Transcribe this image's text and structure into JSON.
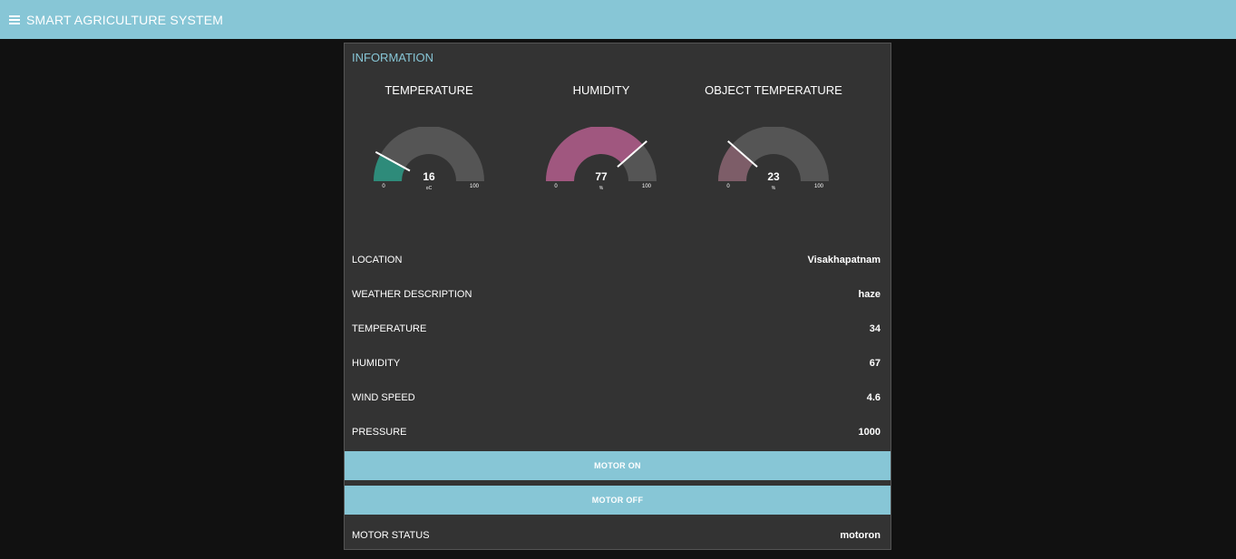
{
  "header": {
    "title": "SMART AGRICULTURE SYSTEM",
    "menu_icon": "hamburger-menu-icon"
  },
  "card": {
    "title": "INFORMATION"
  },
  "gauges": [
    {
      "title": "TEMPERATURE",
      "value": 16,
      "value_text": "16",
      "unit": "oC",
      "min": 0,
      "min_text": "0",
      "max": 100,
      "max_text": "100",
      "color": "#2e8b7a"
    },
    {
      "title": "HUMIDITY",
      "value": 77,
      "value_text": "77",
      "unit": "%",
      "min": 0,
      "min_text": "0",
      "max": 100,
      "max_text": "100",
      "color": "#a0577f"
    },
    {
      "title": "OBJECT TEMPERATURE",
      "value": 23,
      "value_text": "23",
      "unit": "%",
      "min": 0,
      "min_text": "0",
      "max": 100,
      "max_text": "100",
      "color": "#7d5d68"
    }
  ],
  "info_rows": [
    {
      "label": "LOCATION",
      "value": "Visakhapatnam"
    },
    {
      "label": "WEATHER DESCRIPTION",
      "value": "haze"
    },
    {
      "label": "TEMPERATURE",
      "value": "34"
    },
    {
      "label": "HUMIDITY",
      "value": "67"
    },
    {
      "label": "WIND SPEED",
      "value": "4.6"
    },
    {
      "label": "PRESSURE",
      "value": "1000"
    }
  ],
  "buttons": {
    "motor_on": "MOTOR ON",
    "motor_off": "MOTOR OFF"
  },
  "motor_status": {
    "label": "MOTOR STATUS",
    "value": "motoron"
  },
  "colors": {
    "accent": "#87c6d6",
    "background": "#111111",
    "card": "#333333",
    "gauge_track": "#555555"
  }
}
